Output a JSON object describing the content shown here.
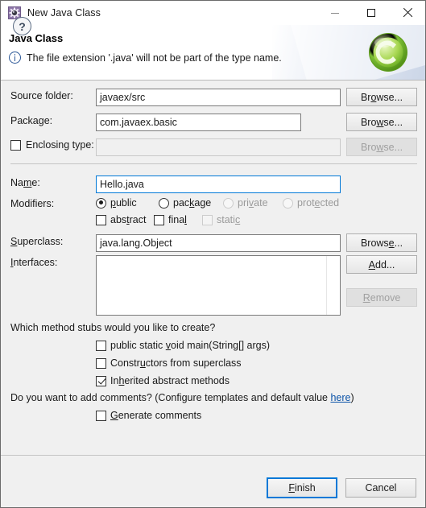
{
  "window": {
    "title": "New Java Class",
    "title_icon": "java-class-wizard-icon",
    "minimize_label": "–",
    "maximize_label": "☐",
    "close_label": "✕"
  },
  "banner": {
    "heading": "Java Class",
    "message": "The file extension '.java' will not be part of the type name.",
    "message_icon": "info-icon",
    "logo": "eclipse-class-logo"
  },
  "form": {
    "source_folder": {
      "label": "Source folder:",
      "value": "javaex/src",
      "browse_label": "Browse..."
    },
    "package": {
      "label": "Package:",
      "value": "com.javaex.basic",
      "browse_label": "Browse..."
    },
    "enclosing_type": {
      "label": "Enclosing type:",
      "checked": false,
      "value": "",
      "browse_label": "Browse...",
      "disabled": true
    },
    "name": {
      "label": "Name:",
      "value": "Hello.java",
      "focused": true
    },
    "modifiers": {
      "label": "Modifiers:",
      "access": [
        {
          "label": "public",
          "selected": true,
          "disabled": false
        },
        {
          "label": "package",
          "selected": false,
          "disabled": false
        },
        {
          "label": "private",
          "selected": false,
          "disabled": true
        },
        {
          "label": "protected",
          "selected": false,
          "disabled": true
        }
      ],
      "flags": [
        {
          "label": "abstract",
          "checked": false,
          "disabled": false
        },
        {
          "label": "final",
          "checked": false,
          "disabled": false
        },
        {
          "label": "static",
          "checked": false,
          "disabled": true
        }
      ]
    },
    "superclass": {
      "label": "Superclass:",
      "value": "java.lang.Object",
      "browse_label": "Browse..."
    },
    "interfaces": {
      "label": "Interfaces:",
      "items": [],
      "add_label": "Add...",
      "remove_label": "Remove",
      "remove_disabled": true
    },
    "stubs": {
      "question": "Which method stubs would you like to create?",
      "options": [
        {
          "label": "public static void main(String[] args)",
          "checked": false
        },
        {
          "label": "Constructors from superclass",
          "checked": false
        },
        {
          "label": "Inherited abstract methods",
          "checked": true
        }
      ]
    },
    "comments": {
      "question_prefix": "Do you want to add comments? (Configure templates and default value ",
      "link_label": "here",
      "question_suffix": ")",
      "option": {
        "label": "Generate comments",
        "checked": false
      }
    }
  },
  "footer": {
    "help_label": "?",
    "help_icon": "help-icon",
    "finish_label": "Finish",
    "cancel_label": "Cancel"
  },
  "colors": {
    "accent": "#0078d7",
    "link": "#0b53a8",
    "dialog_bg": "#f0f0f0",
    "info_blue": "#2b5797",
    "logo_green": "#7ac143"
  }
}
